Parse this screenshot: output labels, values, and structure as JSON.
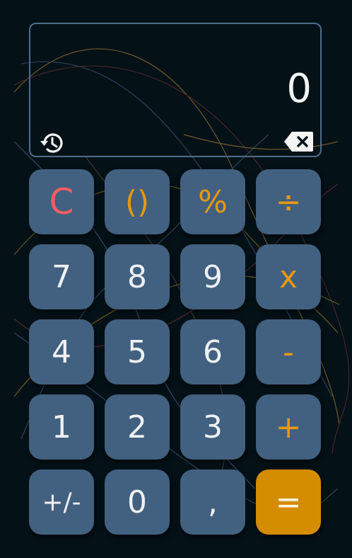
{
  "display": {
    "value": "0"
  },
  "icons": {
    "history": "history-icon",
    "backspace": "backspace-icon"
  },
  "colors": {
    "background": "#041117",
    "key": "#42607f",
    "accent_orange": "#e6990f",
    "clear_red": "#f35c62",
    "equals": "#d48c00",
    "display_border": "#4f6c8d"
  },
  "keys": [
    {
      "label": "C",
      "name": "clear-button",
      "style": "red"
    },
    {
      "label": "()",
      "name": "parentheses-button",
      "style": "orange"
    },
    {
      "label": "%",
      "name": "percent-button",
      "style": "orange"
    },
    {
      "label": "÷",
      "name": "divide-button",
      "style": "orange"
    },
    {
      "label": "7",
      "name": "digit-7-button",
      "style": ""
    },
    {
      "label": "8",
      "name": "digit-8-button",
      "style": ""
    },
    {
      "label": "9",
      "name": "digit-9-button",
      "style": ""
    },
    {
      "label": "x",
      "name": "multiply-button",
      "style": "orange"
    },
    {
      "label": "4",
      "name": "digit-4-button",
      "style": ""
    },
    {
      "label": "5",
      "name": "digit-5-button",
      "style": ""
    },
    {
      "label": "6",
      "name": "digit-6-button",
      "style": ""
    },
    {
      "label": "-",
      "name": "subtract-button",
      "style": "orange"
    },
    {
      "label": "1",
      "name": "digit-1-button",
      "style": ""
    },
    {
      "label": "2",
      "name": "digit-2-button",
      "style": ""
    },
    {
      "label": "3",
      "name": "digit-3-button",
      "style": ""
    },
    {
      "label": "+",
      "name": "add-button",
      "style": "orange"
    },
    {
      "label": "+/-",
      "name": "toggle-sign-button",
      "style": "small"
    },
    {
      "label": "0",
      "name": "digit-0-button",
      "style": ""
    },
    {
      "label": ",",
      "name": "decimal-button",
      "style": ""
    },
    {
      "label": "=",
      "name": "equals-button",
      "style": "eq"
    }
  ]
}
